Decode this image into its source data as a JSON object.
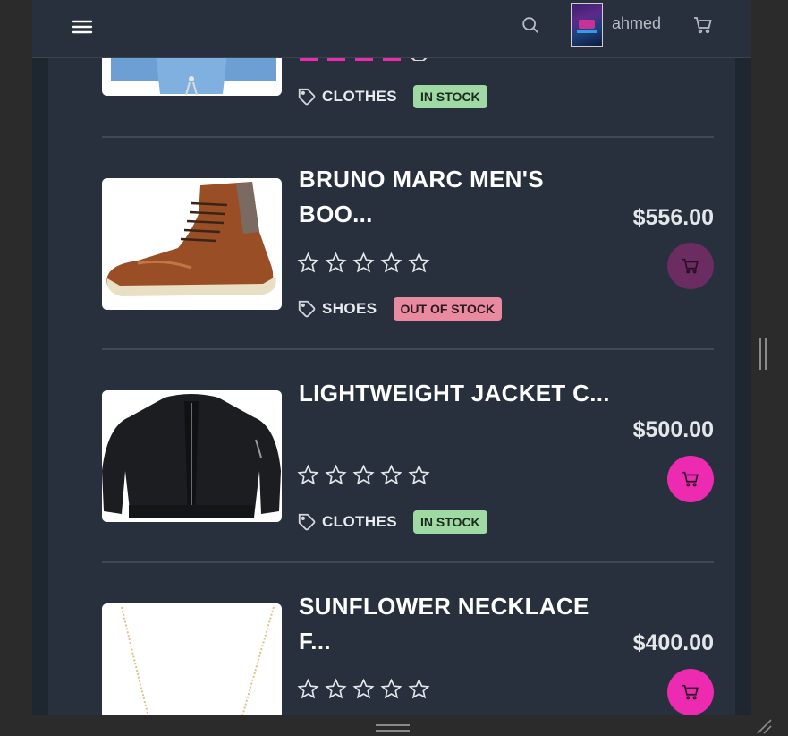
{
  "navbar": {
    "username": "ahmed",
    "icons": [
      "menu-icon",
      "search-icon",
      "cart-icon"
    ]
  },
  "colors": {
    "background": "#27303c",
    "accent": "#ec2bb0",
    "in_stock": "#9fd9a4",
    "out_of_stock": "#e98aa0",
    "divider": "#3e4956"
  },
  "products": [
    {
      "title": "",
      "price": "",
      "category": "CLOTHES",
      "stock": "IN STOCK",
      "image": "denim shirt",
      "rating": 4.5
    },
    {
      "title": "BRUNO MARC MEN'S BOO...",
      "price": "$556.00",
      "category": "SHOES",
      "stock": "OUT OF STOCK",
      "image": "brown leather boot",
      "rating": 0
    },
    {
      "title": "LIGHTWEIGHT JACKET C...",
      "price": "$500.00",
      "category": "CLOTHES",
      "stock": "IN STOCK",
      "image": "black bomber jacket",
      "rating": 0
    },
    {
      "title": "SUNFLOWER NECKLACE F...",
      "price": "$400.00",
      "category": "",
      "stock": "",
      "image": "gold necklace",
      "rating": 0
    }
  ]
}
